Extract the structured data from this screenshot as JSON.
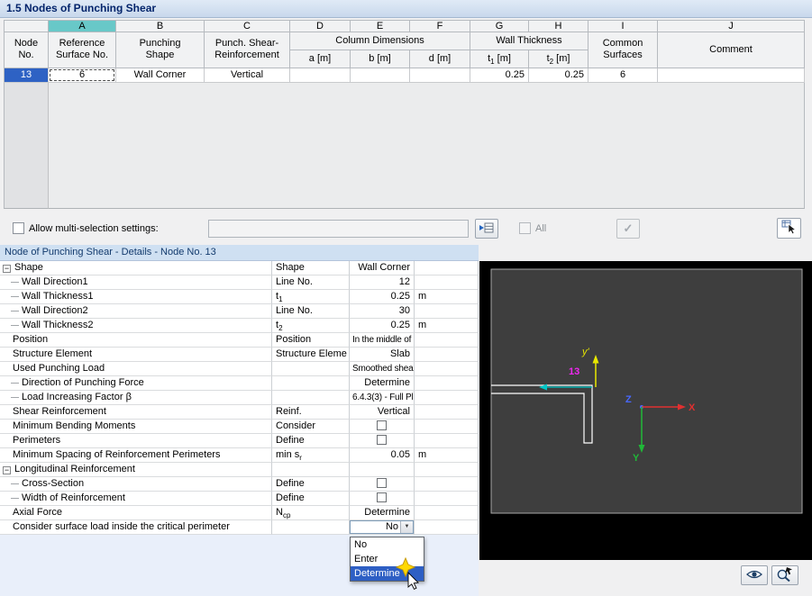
{
  "window": {
    "title": "1.5 Nodes of Punching Shear"
  },
  "icons": {
    "collapse": "−",
    "dropdown_arrow": "▼",
    "check": "✓"
  },
  "grid": {
    "letters": [
      "A",
      "B",
      "C",
      "D",
      "E",
      "F",
      "G",
      "H",
      "I",
      "J"
    ],
    "headers": {
      "node_l1": "Node",
      "node_l2": "No.",
      "a_l1": "Reference",
      "a_l2": "Surface No.",
      "b_l1": "Punching",
      "b_l2": "Shape",
      "c_l1": "Punch. Shear-",
      "c_l2": "Reinforcement",
      "dims_group": "Column Dimensions",
      "d": "a [m]",
      "e": "b [m]",
      "f": "d [m]",
      "wall_group": "Wall Thickness",
      "g_pre": "t",
      "g_sub": "1",
      "g_post": " [m]",
      "h_pre": "t",
      "h_sub": "2",
      "h_post": " [m]",
      "i_l1": "Common",
      "i_l2": "Surfaces",
      "j": "Comment"
    },
    "row": {
      "node": "13",
      "ref_surface": "6",
      "shape": "Wall Corner",
      "reinf": "Vertical",
      "a": "",
      "b": "",
      "d": "",
      "t1": "0.25",
      "t2": "0.25",
      "common": "6",
      "comment": ""
    }
  },
  "multiselect": {
    "label": "Allow multi-selection settings:",
    "input_value": "",
    "all_label": "All"
  },
  "details": {
    "header": "Node of Punching Shear - Details - Node No. 13",
    "rows": [
      {
        "label": "Shape",
        "prop": "Shape",
        "value": "Wall Corner"
      },
      {
        "label": "Wall Direction1",
        "prop": "Line No.",
        "value": "12"
      },
      {
        "label": "Wall Thickness1",
        "prop": "t",
        "prop_sub": "1",
        "value": "0.25",
        "unit": "m"
      },
      {
        "label": "Wall Direction2",
        "prop": "Line No.",
        "value": "30"
      },
      {
        "label": "Wall Thickness2",
        "prop": "t",
        "prop_sub": "2",
        "value": "0.25",
        "unit": "m"
      },
      {
        "label": "Position",
        "prop": "Position",
        "value": "In the middle of"
      },
      {
        "label": "Structure Element",
        "prop": "Structure Eleme",
        "value": "Slab"
      },
      {
        "label": "Used Punching Load",
        "prop": "",
        "value": "Smoothed shea"
      },
      {
        "label": "Direction of Punching Force",
        "prop": "",
        "value": "Determine"
      },
      {
        "label": "Load Increasing Factor β",
        "prop": "",
        "value": "6.4.3(3) - Full Pl"
      },
      {
        "label": "Shear Reinforcement",
        "prop": "Reinf.",
        "value": "Vertical"
      },
      {
        "label": "Minimum Bending Moments",
        "prop": "Consider",
        "checkbox": true
      },
      {
        "label": "Perimeters",
        "prop": "Define",
        "checkbox": true
      },
      {
        "label": "Minimum Spacing of Reinforcement Perimeters",
        "prop": "min s",
        "prop_sub": "r",
        "value": "0.05",
        "unit": "m"
      },
      {
        "label": "Longitudinal Reinforcement",
        "prop": "",
        "value": ""
      },
      {
        "label": "Cross-Section",
        "prop": "Define",
        "checkbox": true
      },
      {
        "label": "Width of Reinforcement",
        "prop": "Define",
        "checkbox": true
      },
      {
        "label": "Axial Force",
        "prop": "N",
        "prop_sub": "cp",
        "value": "Determine"
      },
      {
        "label": "Consider surface load inside the critical perimeter",
        "prop": "",
        "combo_value": "No"
      }
    ],
    "dropdown": {
      "options": [
        "No",
        "Enter",
        "Determine"
      ],
      "selected": "Determine"
    }
  },
  "viewport": {
    "node_label": "13",
    "local_axis_y": "y'",
    "axis_x": "X",
    "axis_y": "Y",
    "axis_z": "Z"
  }
}
